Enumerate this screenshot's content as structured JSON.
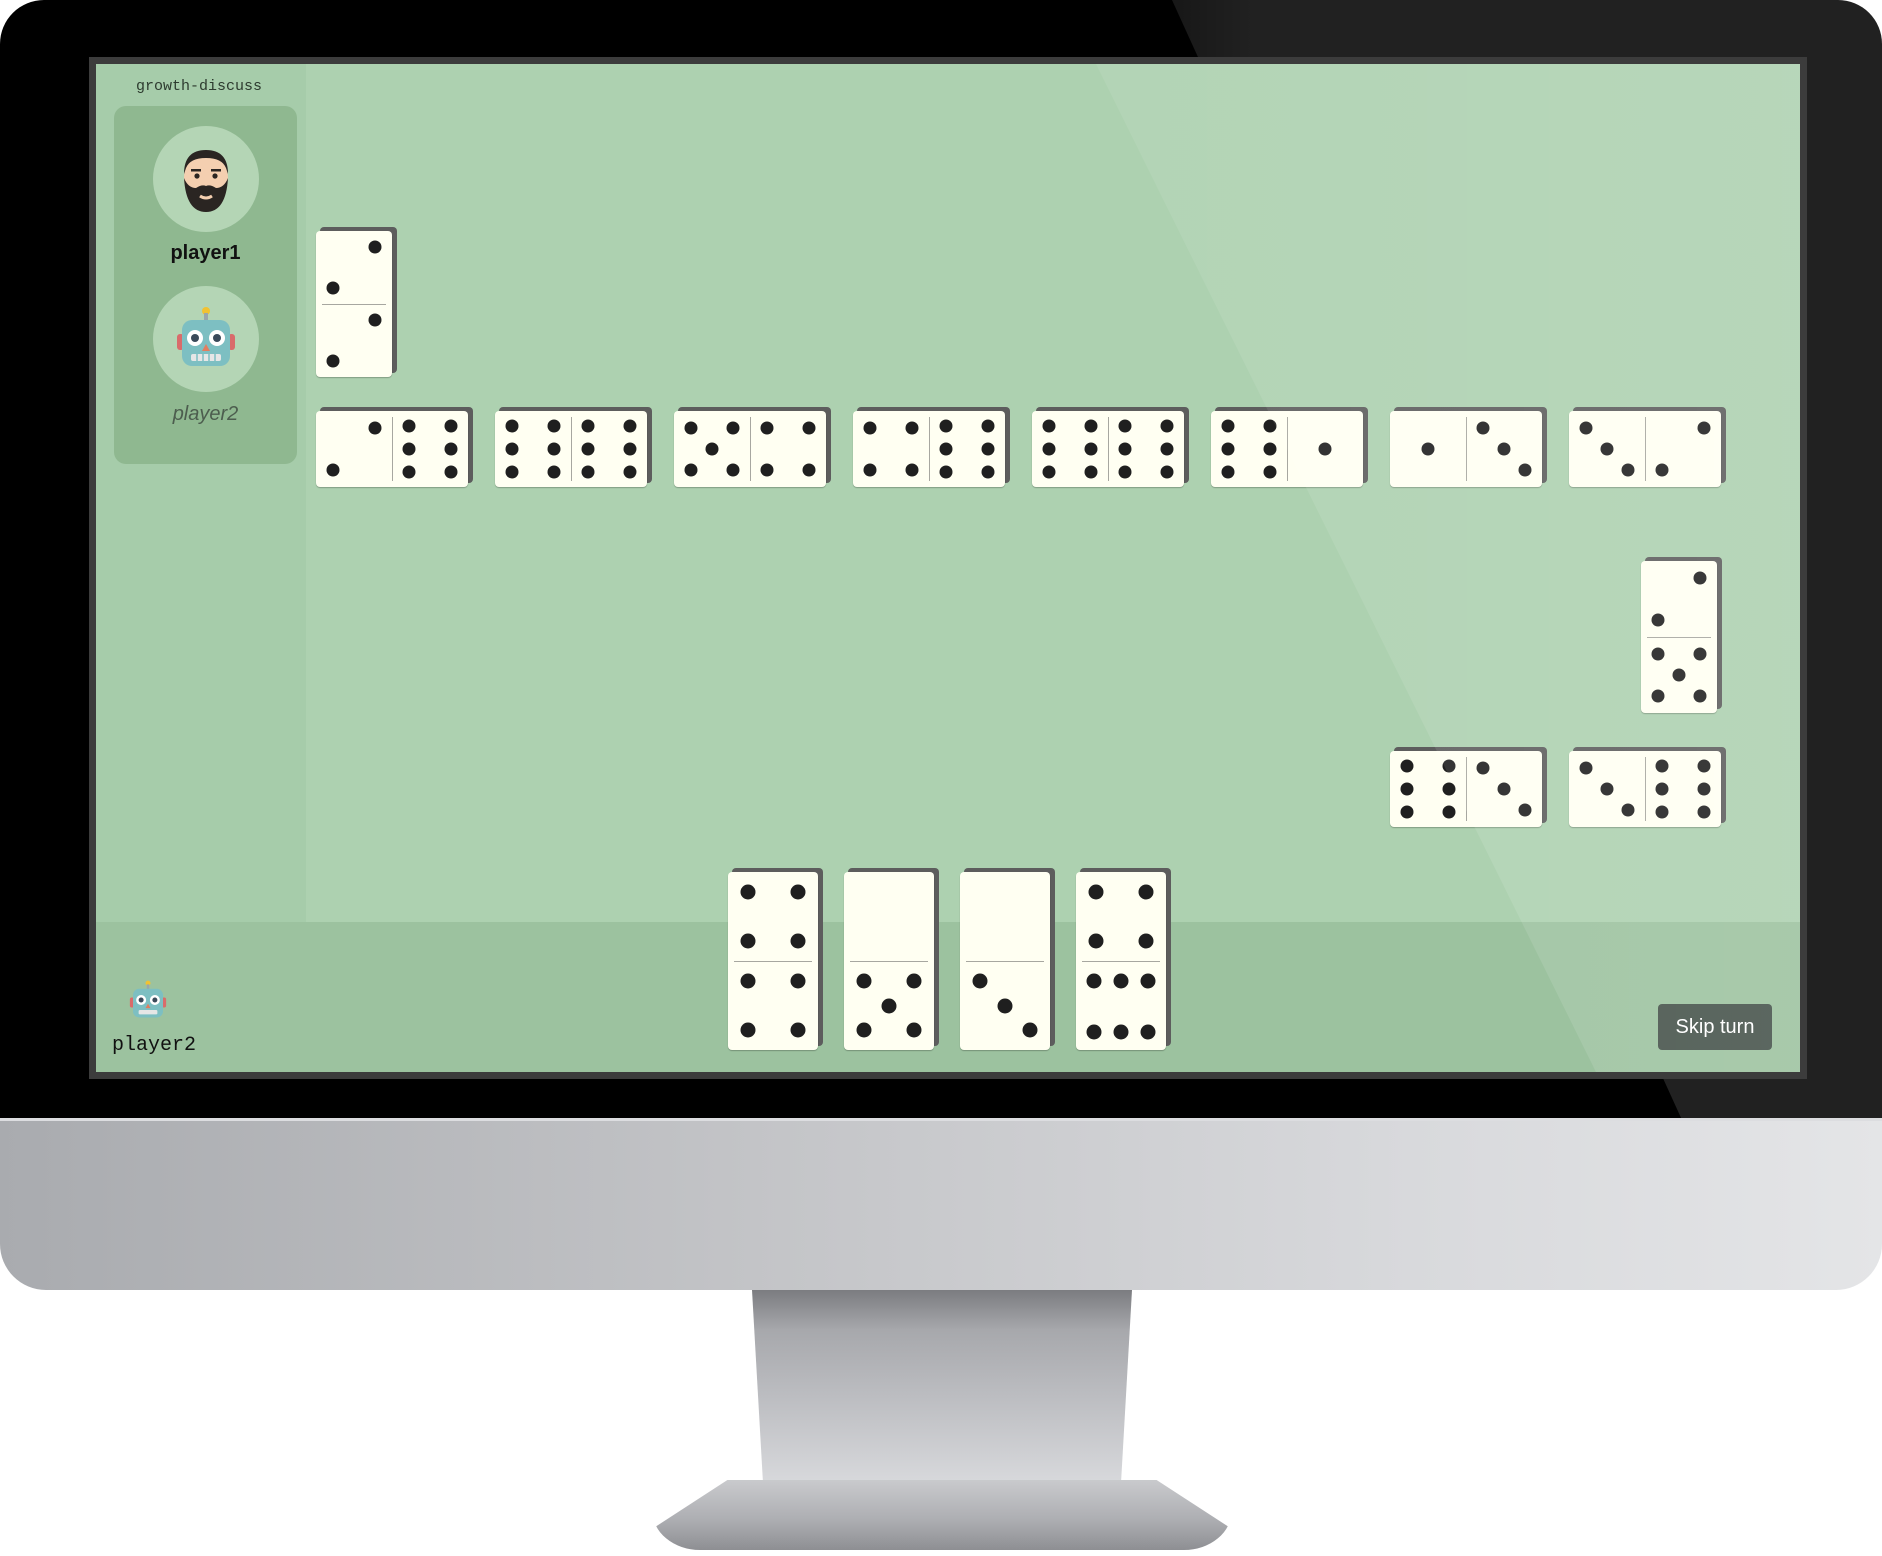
{
  "app": {
    "room_name": "growth-discuss",
    "skip_button_label": "Skip turn"
  },
  "players": [
    {
      "name": "player1",
      "avatar_icon": "bearded-man-icon",
      "active": true
    },
    {
      "name": "player2",
      "avatar_icon": "robot-icon",
      "active": false
    }
  ],
  "current_user": {
    "name": "player2",
    "icon": "robot-icon"
  },
  "board": {
    "vertical_top": [
      2,
      2
    ],
    "row": [
      [
        2,
        6
      ],
      [
        6,
        6
      ],
      [
        5,
        4
      ],
      [
        4,
        6
      ],
      [
        6,
        6
      ],
      [
        6,
        1
      ],
      [
        1,
        3
      ],
      [
        3,
        2
      ]
    ],
    "vertical_right": [
      2,
      5
    ],
    "bottom_row": [
      [
        6,
        3
      ],
      [
        3,
        6
      ]
    ]
  },
  "hand": [
    [
      4,
      4
    ],
    [
      0,
      5
    ],
    [
      0,
      3
    ],
    [
      4,
      6
    ]
  ],
  "colors": {
    "table": "#add1b0",
    "panel": "#8fb890",
    "tile": "#fffff2",
    "pip": "#1f1f1f",
    "button": "#45524a"
  }
}
